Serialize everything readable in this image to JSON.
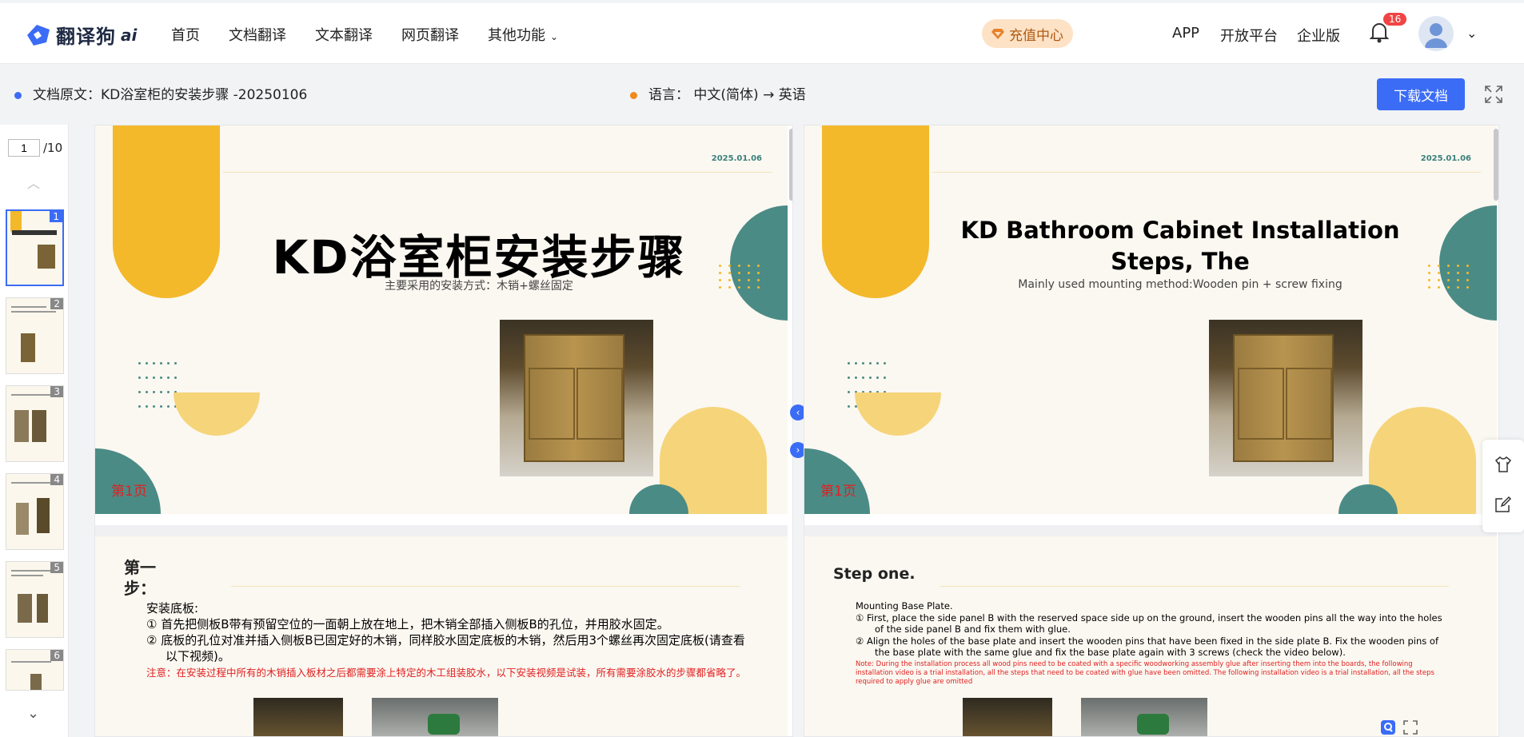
{
  "header": {
    "logo_text": "翻译狗",
    "logo_suffix": "ai",
    "nav": [
      {
        "label": "首页"
      },
      {
        "label": "文档翻译"
      },
      {
        "label": "文本翻译"
      },
      {
        "label": "网页翻译"
      },
      {
        "label": "其他功能"
      }
    ],
    "recharge_label": "充值中心",
    "app_label": "APP",
    "open_platform_label": "开放平台",
    "enterprise_label": "企业版",
    "notification_count": "16"
  },
  "infobar": {
    "doc_name": "文档原文：KD浴室柜的安装步骤 -20250106",
    "language": "语言：  中文(简体) → 英语",
    "download_label": "下载文档"
  },
  "thumbnails": {
    "current_page": "1",
    "total_pages": "/10",
    "pages": [
      {
        "num": "1"
      },
      {
        "num": "2"
      },
      {
        "num": "3"
      },
      {
        "num": "4"
      },
      {
        "num": "5"
      },
      {
        "num": "6"
      }
    ]
  },
  "original": {
    "slide1": {
      "date": "2025.01.06",
      "title": "KD浴室柜安装步骤",
      "subtitle": "主要采用的安装方式：木销+螺丝固定",
      "page_label": "第1页"
    },
    "slide2": {
      "step_line1": "第一",
      "step_line2": "步：",
      "heading": "安装底板:",
      "item1": "①  首先把侧板B带有预留空位的一面朝上放在地上，把木销全部插入侧板B的孔位，并用胶水固定。",
      "item2": "②  底板的孔位对准并插入侧板B已固定好的木销，同样胶水固定底板的木销，然后用3个螺丝再次固定底板(请查看以下视频)。",
      "note": "注意：在安装过程中所有的木销插入板材之后都需要涂上特定的木工组装胶水，以下安装视频是试装，所有需要涂胶水的步骤都省略了。"
    }
  },
  "translated": {
    "slide1": {
      "date": "2025.01.06",
      "title": "KD Bathroom Cabinet Installation Steps, The",
      "subtitle": "Mainly used mounting method:Wooden pin + screw fixing",
      "page_label": "第1页"
    },
    "slide2": {
      "step": "Step one.",
      "heading": "Mounting Base Plate.",
      "item1": "①   First, place the side panel B with the reserved space side up on the ground, insert the wooden pins all the way into the holes of the side panel B and fix them with glue.",
      "item2": "②   Align the holes of the base plate and insert the wooden pins that have been fixed in the side plate B. Fix the wooden pins of the base plate with the same glue and fix the base plate again with 3 screws (check the video below).",
      "note": "Note: During the installation process all wood pins need to be coated with a specific woodworking assembly glue after inserting them into the boards, the following installation video is a trial installation, all the steps that need to be coated with glue have been omitted. The following installation video is a trial installation, all the steps required to apply glue are omitted"
    }
  },
  "colors": {
    "accent": "#3b6cf6",
    "slide_yellow": "#f3b92b",
    "slide_teal": "#4b8b86",
    "note_red": "#e02020"
  }
}
